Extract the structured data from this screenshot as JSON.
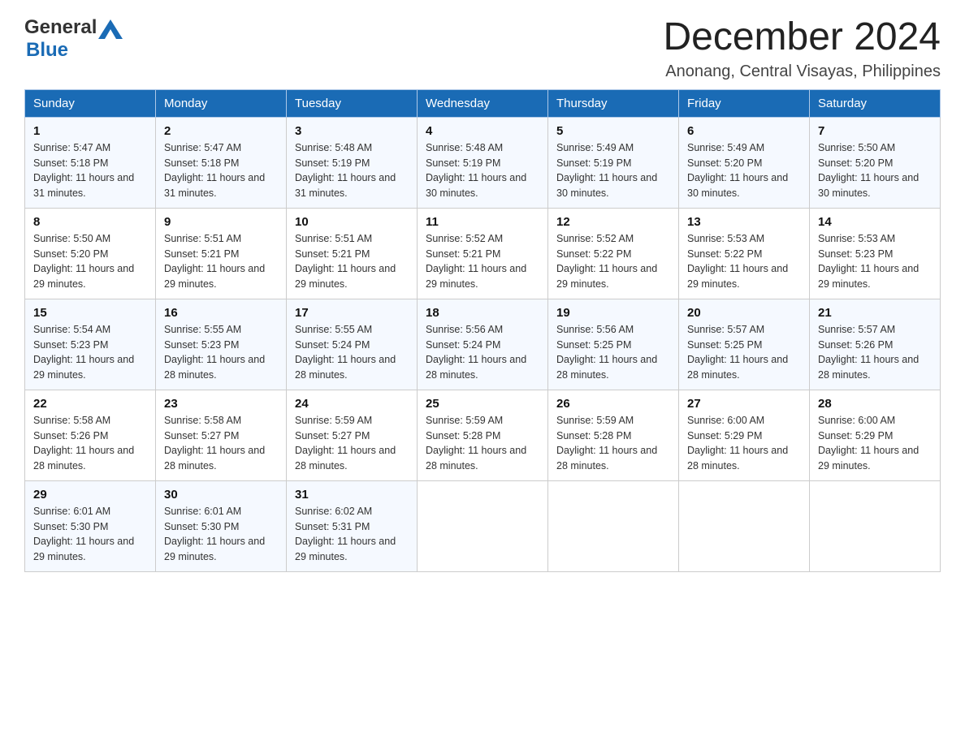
{
  "header": {
    "logo_general": "General",
    "logo_blue": "Blue",
    "month_title": "December 2024",
    "location": "Anonang, Central Visayas, Philippines"
  },
  "days_of_week": [
    "Sunday",
    "Monday",
    "Tuesday",
    "Wednesday",
    "Thursday",
    "Friday",
    "Saturday"
  ],
  "weeks": [
    [
      {
        "day": "1",
        "sunrise": "5:47 AM",
        "sunset": "5:18 PM",
        "daylight": "11 hours and 31 minutes."
      },
      {
        "day": "2",
        "sunrise": "5:47 AM",
        "sunset": "5:18 PM",
        "daylight": "11 hours and 31 minutes."
      },
      {
        "day": "3",
        "sunrise": "5:48 AM",
        "sunset": "5:19 PM",
        "daylight": "11 hours and 31 minutes."
      },
      {
        "day": "4",
        "sunrise": "5:48 AM",
        "sunset": "5:19 PM",
        "daylight": "11 hours and 30 minutes."
      },
      {
        "day": "5",
        "sunrise": "5:49 AM",
        "sunset": "5:19 PM",
        "daylight": "11 hours and 30 minutes."
      },
      {
        "day": "6",
        "sunrise": "5:49 AM",
        "sunset": "5:20 PM",
        "daylight": "11 hours and 30 minutes."
      },
      {
        "day": "7",
        "sunrise": "5:50 AM",
        "sunset": "5:20 PM",
        "daylight": "11 hours and 30 minutes."
      }
    ],
    [
      {
        "day": "8",
        "sunrise": "5:50 AM",
        "sunset": "5:20 PM",
        "daylight": "11 hours and 29 minutes."
      },
      {
        "day": "9",
        "sunrise": "5:51 AM",
        "sunset": "5:21 PM",
        "daylight": "11 hours and 29 minutes."
      },
      {
        "day": "10",
        "sunrise": "5:51 AM",
        "sunset": "5:21 PM",
        "daylight": "11 hours and 29 minutes."
      },
      {
        "day": "11",
        "sunrise": "5:52 AM",
        "sunset": "5:21 PM",
        "daylight": "11 hours and 29 minutes."
      },
      {
        "day": "12",
        "sunrise": "5:52 AM",
        "sunset": "5:22 PM",
        "daylight": "11 hours and 29 minutes."
      },
      {
        "day": "13",
        "sunrise": "5:53 AM",
        "sunset": "5:22 PM",
        "daylight": "11 hours and 29 minutes."
      },
      {
        "day": "14",
        "sunrise": "5:53 AM",
        "sunset": "5:23 PM",
        "daylight": "11 hours and 29 minutes."
      }
    ],
    [
      {
        "day": "15",
        "sunrise": "5:54 AM",
        "sunset": "5:23 PM",
        "daylight": "11 hours and 29 minutes."
      },
      {
        "day": "16",
        "sunrise": "5:55 AM",
        "sunset": "5:23 PM",
        "daylight": "11 hours and 28 minutes."
      },
      {
        "day": "17",
        "sunrise": "5:55 AM",
        "sunset": "5:24 PM",
        "daylight": "11 hours and 28 minutes."
      },
      {
        "day": "18",
        "sunrise": "5:56 AM",
        "sunset": "5:24 PM",
        "daylight": "11 hours and 28 minutes."
      },
      {
        "day": "19",
        "sunrise": "5:56 AM",
        "sunset": "5:25 PM",
        "daylight": "11 hours and 28 minutes."
      },
      {
        "day": "20",
        "sunrise": "5:57 AM",
        "sunset": "5:25 PM",
        "daylight": "11 hours and 28 minutes."
      },
      {
        "day": "21",
        "sunrise": "5:57 AM",
        "sunset": "5:26 PM",
        "daylight": "11 hours and 28 minutes."
      }
    ],
    [
      {
        "day": "22",
        "sunrise": "5:58 AM",
        "sunset": "5:26 PM",
        "daylight": "11 hours and 28 minutes."
      },
      {
        "day": "23",
        "sunrise": "5:58 AM",
        "sunset": "5:27 PM",
        "daylight": "11 hours and 28 minutes."
      },
      {
        "day": "24",
        "sunrise": "5:59 AM",
        "sunset": "5:27 PM",
        "daylight": "11 hours and 28 minutes."
      },
      {
        "day": "25",
        "sunrise": "5:59 AM",
        "sunset": "5:28 PM",
        "daylight": "11 hours and 28 minutes."
      },
      {
        "day": "26",
        "sunrise": "5:59 AM",
        "sunset": "5:28 PM",
        "daylight": "11 hours and 28 minutes."
      },
      {
        "day": "27",
        "sunrise": "6:00 AM",
        "sunset": "5:29 PM",
        "daylight": "11 hours and 28 minutes."
      },
      {
        "day": "28",
        "sunrise": "6:00 AM",
        "sunset": "5:29 PM",
        "daylight": "11 hours and 29 minutes."
      }
    ],
    [
      {
        "day": "29",
        "sunrise": "6:01 AM",
        "sunset": "5:30 PM",
        "daylight": "11 hours and 29 minutes."
      },
      {
        "day": "30",
        "sunrise": "6:01 AM",
        "sunset": "5:30 PM",
        "daylight": "11 hours and 29 minutes."
      },
      {
        "day": "31",
        "sunrise": "6:02 AM",
        "sunset": "5:31 PM",
        "daylight": "11 hours and 29 minutes."
      },
      null,
      null,
      null,
      null
    ]
  ],
  "labels": {
    "sunrise": "Sunrise: ",
    "sunset": "Sunset: ",
    "daylight": "Daylight: "
  }
}
